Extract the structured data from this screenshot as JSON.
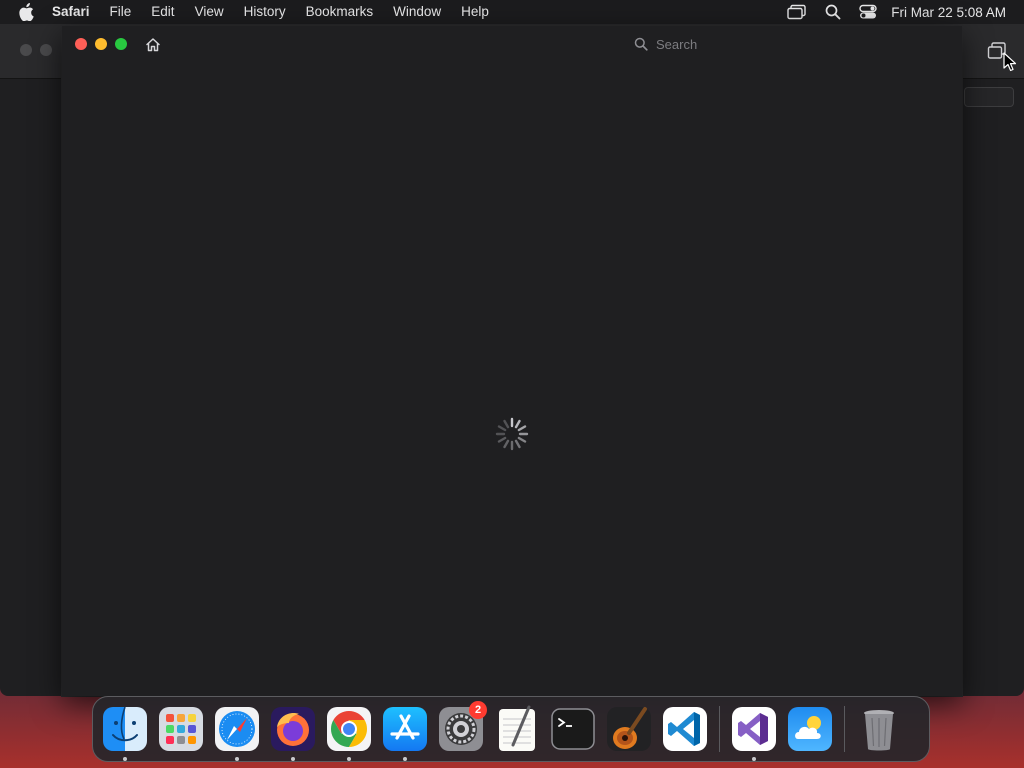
{
  "menubar": {
    "app_name": "Safari",
    "items": [
      "File",
      "Edit",
      "View",
      "History",
      "Bookmarks",
      "Window",
      "Help"
    ],
    "status_icons": [
      "screen-mirroring-icon",
      "spotlight-search-icon",
      "control-center-icon"
    ],
    "clock": "Fri Mar 22  5:08 AM"
  },
  "browser": {
    "search_placeholder": "Search",
    "state": "loading"
  },
  "dock": {
    "apps": [
      {
        "name": "Finder",
        "icon": "finder-icon",
        "running": true
      },
      {
        "name": "Launchpad",
        "icon": "launchpad-icon",
        "running": false
      },
      {
        "name": "Safari",
        "icon": "safari-icon",
        "running": true
      },
      {
        "name": "Firefox",
        "icon": "firefox-icon",
        "running": true
      },
      {
        "name": "Google Chrome",
        "icon": "chrome-icon",
        "running": true
      },
      {
        "name": "App Store",
        "icon": "app-store-icon",
        "running": true
      },
      {
        "name": "System Settings",
        "icon": "system-settings-icon",
        "running": false,
        "badge": "2"
      },
      {
        "name": "TextEdit",
        "icon": "textedit-icon",
        "running": false
      },
      {
        "name": "Terminal",
        "icon": "terminal-icon",
        "running": false
      },
      {
        "name": "GarageBand",
        "icon": "garageband-icon",
        "running": false
      },
      {
        "name": "Visual Studio Code",
        "icon": "vscode-icon",
        "running": false
      },
      {
        "name": "Visual Studio",
        "icon": "visual-studio-icon",
        "running": true
      },
      {
        "name": "Weather",
        "icon": "weather-icon",
        "running": false
      },
      {
        "name": "Trash",
        "icon": "trash-icon",
        "running": false
      }
    ]
  },
  "colors": {
    "close": "#fe5f57",
    "minimize": "#febc2e",
    "zoom": "#28c840",
    "badge": "#ff3b30"
  }
}
